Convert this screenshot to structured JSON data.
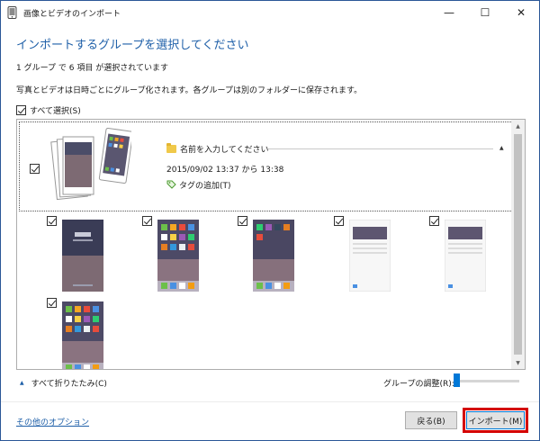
{
  "window": {
    "title": "画像とビデオのインポート",
    "minimize_glyph": "—",
    "maximize_glyph": "☐",
    "close_glyph": "✕",
    "app_icon": "phone-icon"
  },
  "heading": "インポートするグループを選択してください",
  "summary": "1 グループ で 6 項目 が選択されています",
  "description": "写真とビデオは日時ごとにグループ化されます。各グループは別のフォルダーに保存されます。",
  "select_all": {
    "label": "すべて選択(S)",
    "checked": true
  },
  "group": {
    "checked": true,
    "name_placeholder": "名前を入力してください",
    "date_range": "2015/09/02 13:37 から 13:38",
    "add_tag_label": "タグの追加(T)",
    "collapse_glyph": "▲"
  },
  "items": [
    {
      "checked": true,
      "kind": "lockscreen"
    },
    {
      "checked": true,
      "kind": "homescreen"
    },
    {
      "checked": true,
      "kind": "homescreen-dark"
    },
    {
      "checked": true,
      "kind": "settings"
    },
    {
      "checked": true,
      "kind": "settings"
    },
    {
      "checked": true,
      "kind": "homescreen"
    }
  ],
  "scrollbar": {
    "up_glyph": "▲",
    "down_glyph": "▼"
  },
  "footer": {
    "collapse_all_label": "すべて折りたたみ(C)",
    "collapse_glyph": "▲",
    "group_adjust_label": "グループの調整(R):",
    "group_adjust_level": 0,
    "options_link": "その他のオプション",
    "back_button": "戻る(B)",
    "import_button": "インポート(M)"
  },
  "colors": {
    "accent": "#1e5fa8",
    "highlight": "#d40000",
    "slider": "#0078d7"
  }
}
